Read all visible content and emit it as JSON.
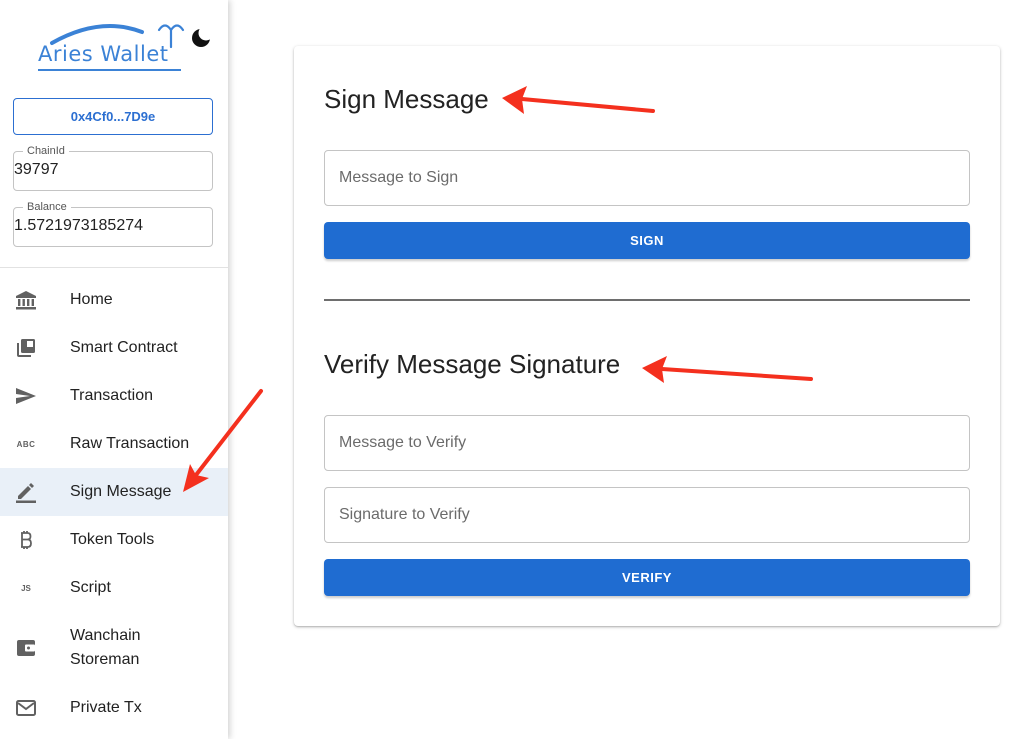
{
  "app": {
    "logo_text": "Aries Wallet"
  },
  "account": {
    "address": "0x4Cf0...7D9e",
    "chain_id_label": "ChainId",
    "chain_id": "39797",
    "balance_label": "Balance",
    "balance": "1.5721973185274"
  },
  "nav": {
    "items": [
      {
        "label": "Home",
        "icon": "bank-icon"
      },
      {
        "label": "Smart Contract",
        "icon": "library-books-icon"
      },
      {
        "label": "Transaction",
        "icon": "send-icon"
      },
      {
        "label": "Raw Transaction",
        "icon": "abc-icon",
        "icon_text": "ABC"
      },
      {
        "label": "Sign Message",
        "icon": "pen-icon",
        "active": true
      },
      {
        "label": "Token Tools",
        "icon": "bitcoin-icon"
      },
      {
        "label": "Script",
        "icon": "js-icon",
        "icon_text": "JS"
      },
      {
        "label": "Wanchain Storeman",
        "icon": "wallet-icon",
        "lines": [
          "Wanchain",
          "Storeman"
        ]
      },
      {
        "label": "Private Tx",
        "icon": "mail-icon"
      }
    ]
  },
  "sign": {
    "title": "Sign Message",
    "message_placeholder": "Message to Sign",
    "button": "SIGN"
  },
  "verify": {
    "title": "Verify Message Signature",
    "message_placeholder": "Message to Verify",
    "signature_placeholder": "Signature to Verify",
    "button": "VERIFY"
  },
  "colors": {
    "accent": "#1f6cd1",
    "annotation": "#f4301e",
    "active_bg": "#e9f0f8"
  }
}
